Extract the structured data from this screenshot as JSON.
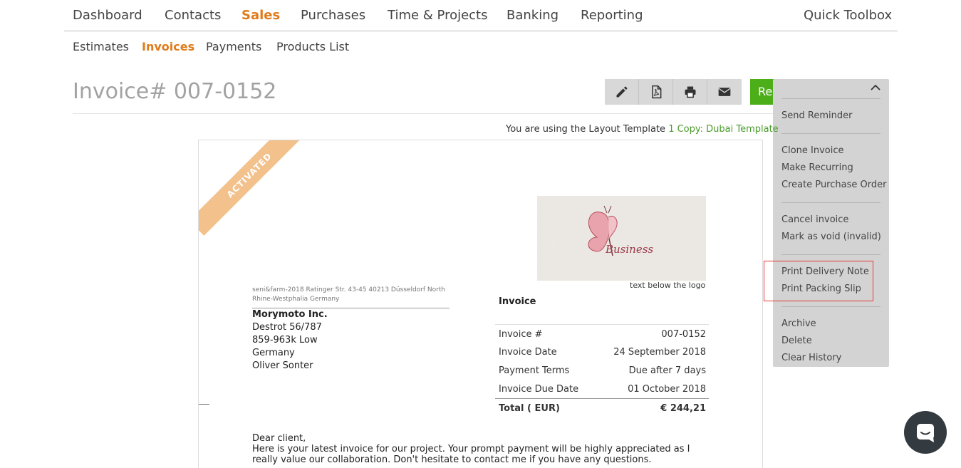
{
  "topnav": {
    "items": [
      "Dashboard",
      "Contacts",
      "Sales",
      "Purchases",
      "Time & Projects",
      "Banking",
      "Reporting"
    ],
    "quick_toolbox": "Quick Toolbox"
  },
  "subnav": {
    "items": [
      "Estimates",
      "Invoices",
      "Payments",
      "Products List"
    ]
  },
  "page": {
    "title": "Invoice# 007-0152"
  },
  "toolbar": {
    "buttons": [
      "pencil-icon",
      "pdf-icon",
      "printer-icon",
      "envelope-icon"
    ],
    "green_label": "Re"
  },
  "dropdown": {
    "items": [
      "Send Reminder",
      "Clone Invoice",
      "Make Recurring",
      "Create Purchase Order",
      "Cancel invoice",
      "Mark as void (invalid)",
      "Print Delivery Note",
      "Print Packing Slip",
      "Archive",
      "Delete",
      "Clear History"
    ]
  },
  "template_note": {
    "prefix": "You are using the Layout Template",
    "link": "1 Copy: Dubai Template"
  },
  "document": {
    "ribbon": "ACTIVATED",
    "logo_text": "Business",
    "below_logo": "text below the logo",
    "sender_line": "seni&farm-2018 Ratinger Str. 43-45 40213 Düsseldorf North Rhine-Westphalia Germany",
    "recipient": [
      "Morymoto Inc.",
      "Destrot 56/787",
      "859-963k Low",
      "Germany",
      "Oliver Sonter"
    ],
    "invoice_title": "Invoice",
    "rows": [
      {
        "label": "Invoice #",
        "value": "007-0152"
      },
      {
        "label": "Invoice Date",
        "value": "24 September 2018"
      },
      {
        "label": "Payment Terms",
        "value": "Due after 7 days"
      },
      {
        "label": "Invoice Due Date",
        "value": "01 October 2018"
      }
    ],
    "total": {
      "label": "Total ( EUR)",
      "value": "€ 244,21"
    },
    "letter": {
      "greeting": "Dear client,",
      "body": "Here is your latest invoice for our project. Your prompt payment will be highly appreciated as I really value our collaboration. Don't hesitate to contact me if you have any questions."
    }
  },
  "colors": {
    "accent": "#e07b1a",
    "green": "#4caf1a",
    "link": "#4a9c2a",
    "highlight": "#e53935",
    "ribbon": "#f2c18c"
  }
}
